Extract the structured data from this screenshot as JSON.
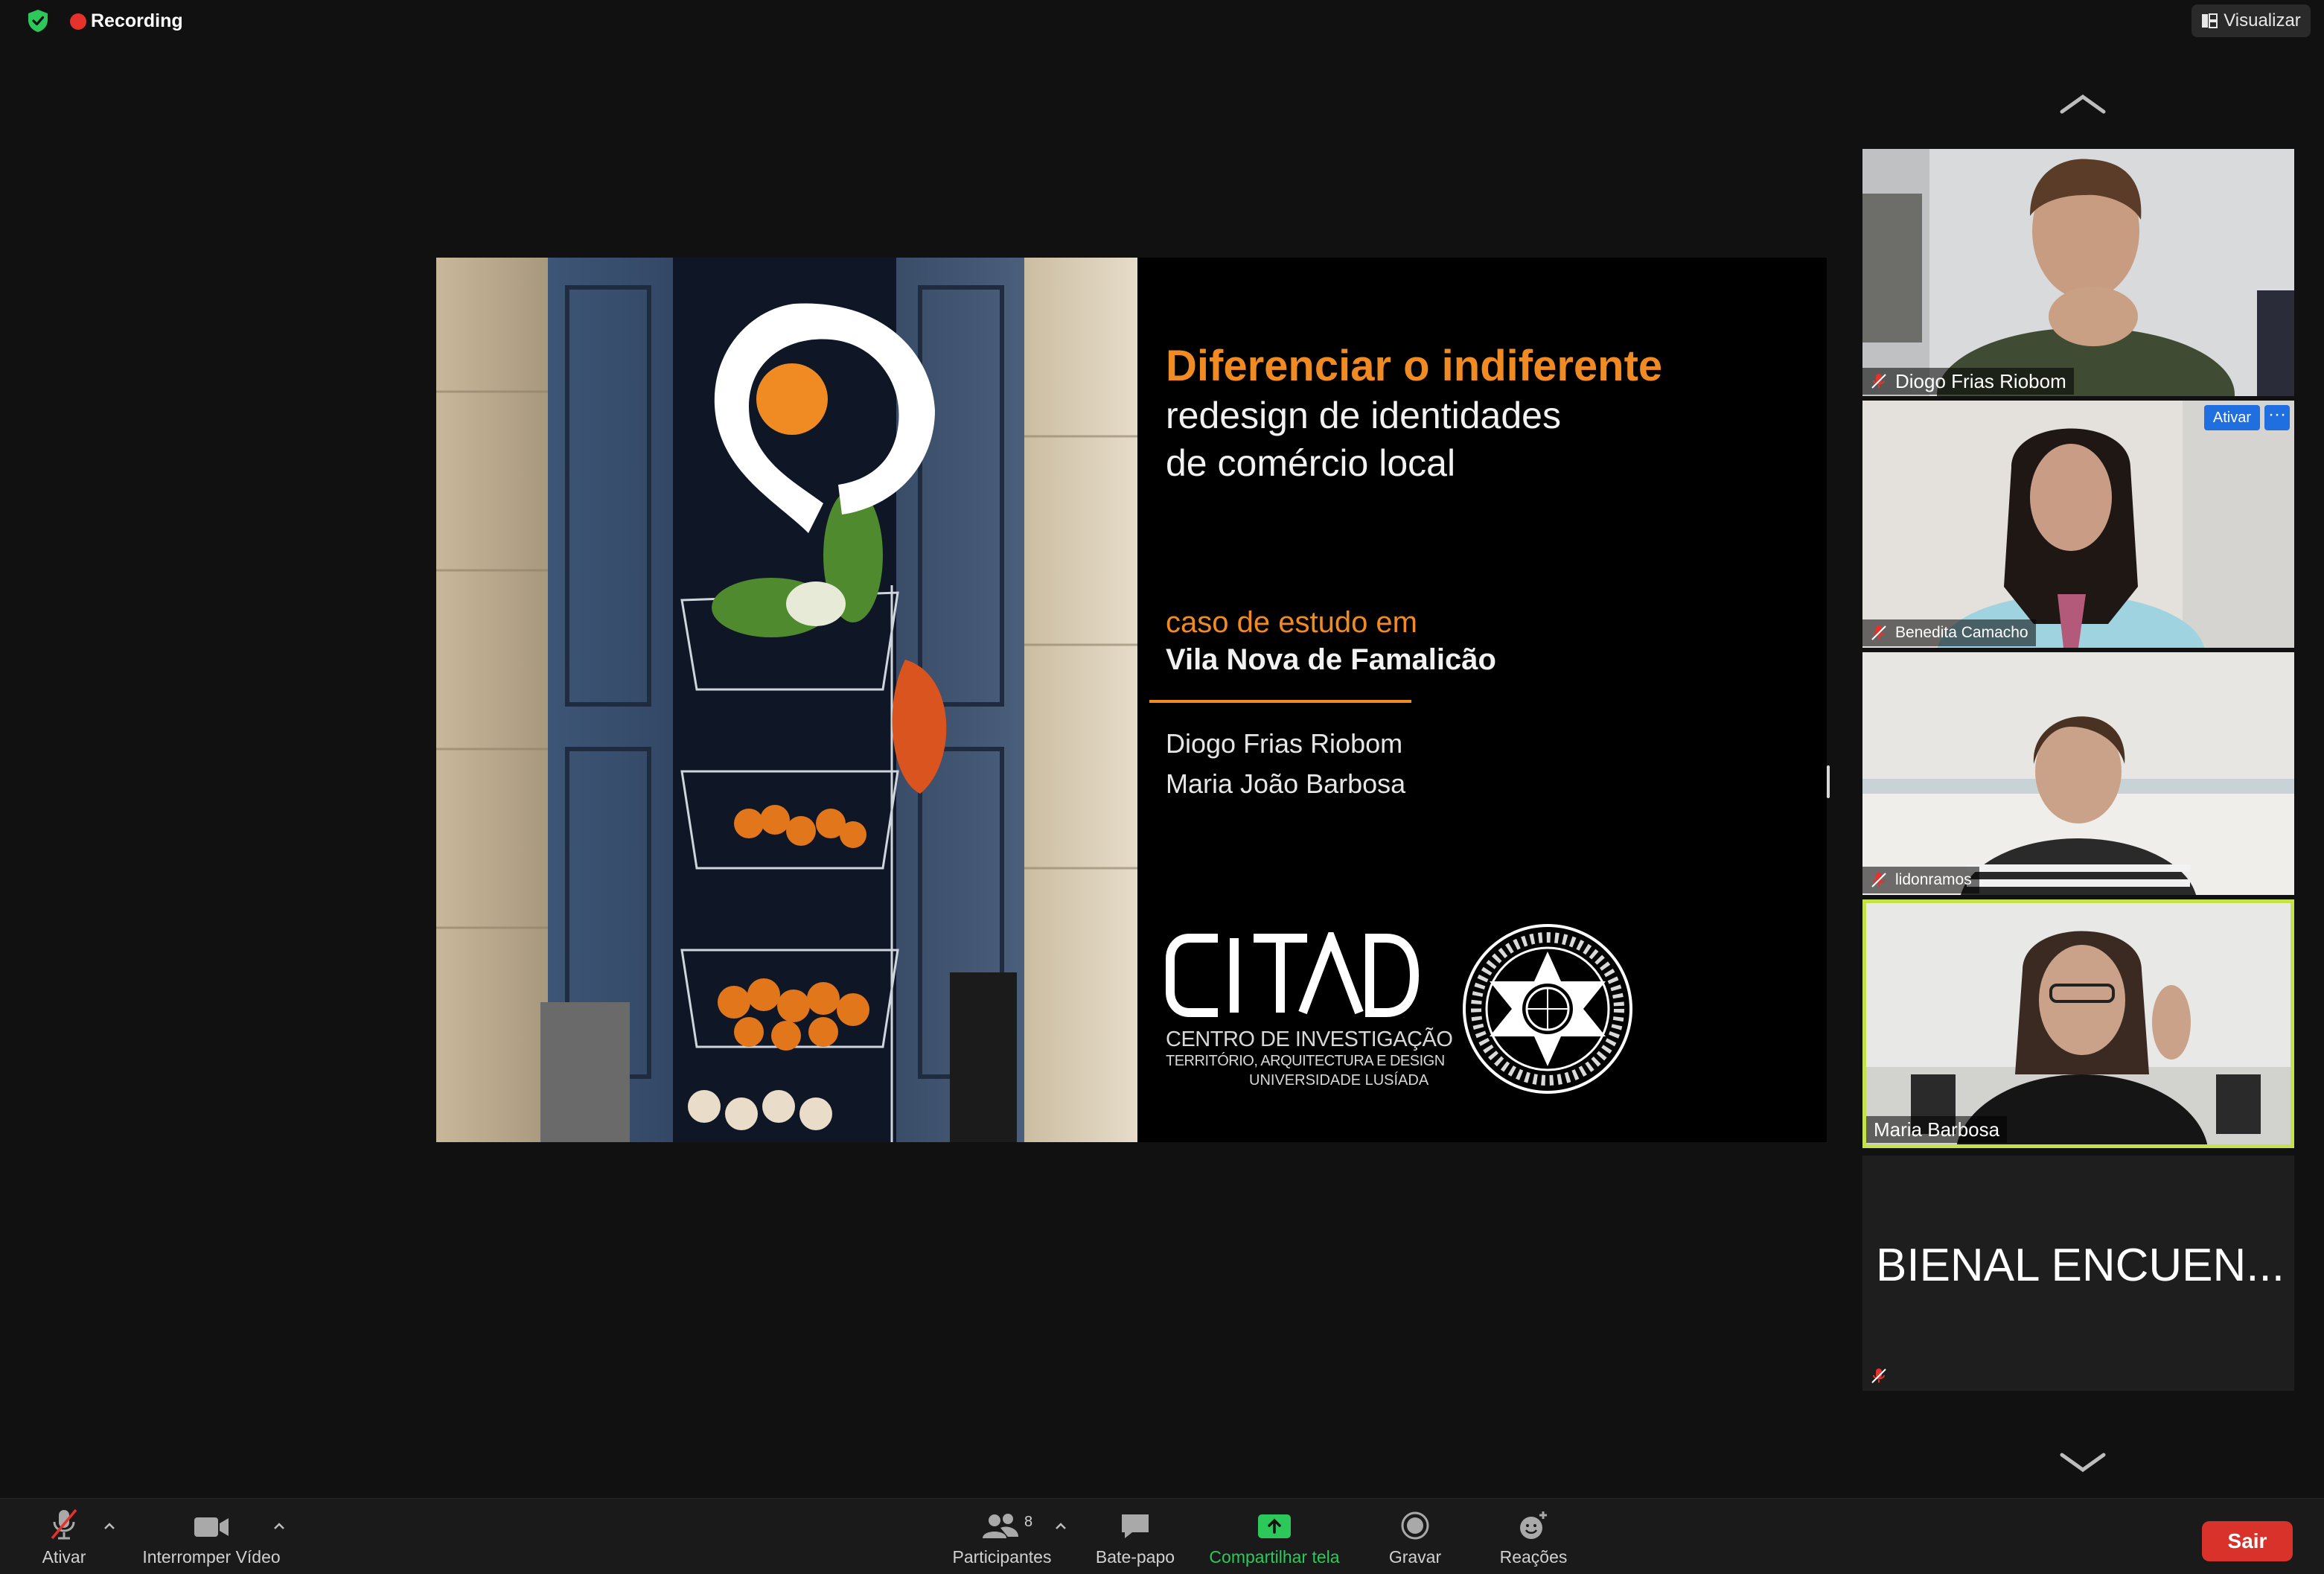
{
  "topbar": {
    "recording_label": "Recording",
    "view_label": "Visualizar"
  },
  "slide": {
    "title": "Diferenciar o indiferente",
    "subtitle_line1": "redesign de identidades",
    "subtitle_line2": "de comércio local",
    "case_label": "caso de estudo em",
    "case_place": "Vila Nova de Famalicão",
    "author1": "Diogo Frias Riobom",
    "author2": "Maria João Barbosa",
    "citad_line1": "CENTRO DE INVESTIGAÇÃO",
    "citad_line2": "TERRITÓRIO, ARQUITECTURA E DESIGN",
    "citad_line3": "UNIVERSIDADE LUSÍADA",
    "accent_color": "#f08b24"
  },
  "participants": [
    {
      "name": "Diogo Frias Riobom",
      "muted": true
    },
    {
      "name": "Benedita Camacho",
      "muted": true,
      "ativar_label": "Ativar",
      "more_label": "···"
    },
    {
      "name": "lidonramos",
      "muted": true
    },
    {
      "name": "Maria Barbosa",
      "muted": false,
      "active_speaker": true
    },
    {
      "name": "BIENAL ENCUEN...",
      "muted": true
    }
  ],
  "toolbar": {
    "mute_label": "Ativar",
    "video_label": "Interromper Vídeo",
    "participants_label": "Participantes",
    "participants_count": "8",
    "chat_label": "Bate-papo",
    "share_label": "Compartilhar tela",
    "record_label": "Gravar",
    "reactions_label": "Reações",
    "leave_label": "Sair",
    "share_color": "#2dc85a",
    "leave_color": "#d8322b"
  }
}
